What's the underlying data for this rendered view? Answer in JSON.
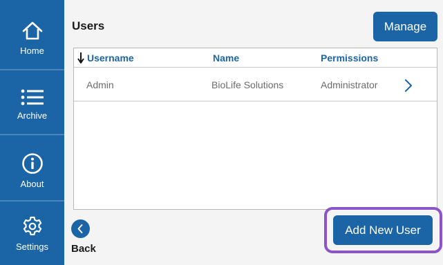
{
  "sidebar": {
    "items": [
      {
        "label": "Home",
        "icon": "home-icon"
      },
      {
        "label": "Archive",
        "icon": "list-icon"
      },
      {
        "label": "About",
        "icon": "info-icon"
      },
      {
        "label": "Settings",
        "icon": "gear-icon"
      }
    ]
  },
  "page": {
    "title": "Users",
    "manage_label": "Manage",
    "add_user_label": "Add New User",
    "back_label": "Back"
  },
  "table": {
    "columns": [
      "Username",
      "Name",
      "Permissions"
    ],
    "sort_column": "Username",
    "sort_direction": "descending",
    "rows": [
      {
        "username": "Admin",
        "name": "BioLife Solutions",
        "permissions": "Administrator"
      }
    ]
  },
  "colors": {
    "primary": "#1b65a6",
    "highlight": "#8b55c9",
    "header_text": "#1b65a6",
    "cell_text": "#6b6b6b"
  }
}
